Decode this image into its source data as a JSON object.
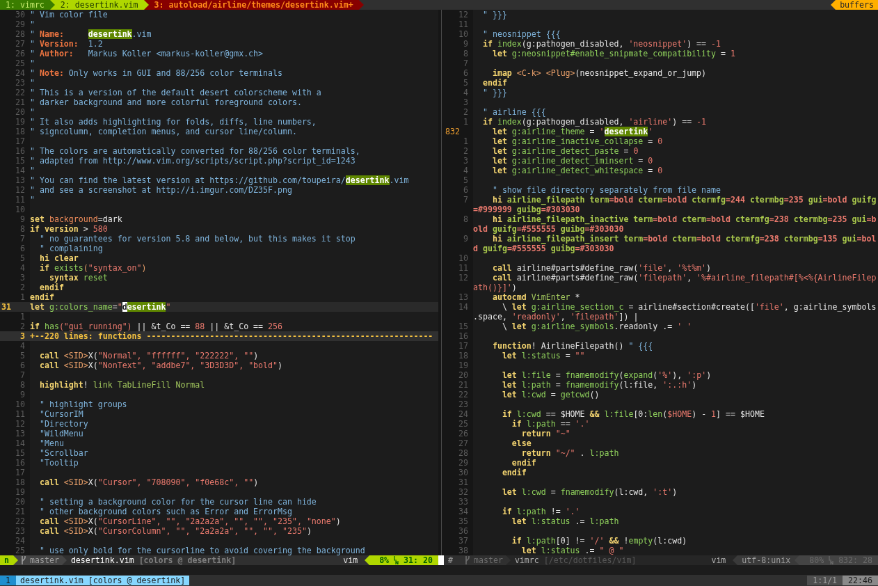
{
  "tabline": {
    "tabs": [
      {
        "label": "1: vimrc",
        "kind": "hidden",
        "selected": false
      },
      {
        "label": "2: desertink.vim",
        "kind": "visible",
        "selected": false
      },
      {
        "label": "3: autoload/airline/themes/desertink.vim+",
        "kind": "modified",
        "selected": true
      }
    ],
    "buffers_label": "buffers"
  },
  "panes": [
    {
      "active": true,
      "rows": [
        {
          "number": "30",
          "segments": [
            {
              "text": "\" Vim color file",
              "kind": "comment"
            }
          ]
        },
        {
          "number": "29",
          "segments": [
            {
              "text": "\"",
              "kind": "comment"
            }
          ]
        },
        {
          "number": "28",
          "segments": [
            {
              "text": "\" ",
              "kind": "comment"
            },
            {
              "text": "Name:     ",
              "kind": "label"
            },
            {
              "text": "desertink",
              "kind": "match"
            },
            {
              "text": ".vim",
              "kind": "comment"
            }
          ]
        },
        {
          "number": "27",
          "segments": [
            {
              "text": "\" ",
              "kind": "comment"
            },
            {
              "text": "Version:",
              "kind": "label"
            },
            {
              "text": "  1.2",
              "kind": "comment"
            }
          ]
        },
        {
          "number": "26",
          "segments": [
            {
              "text": "\" ",
              "kind": "comment"
            },
            {
              "text": "Author:",
              "kind": "label"
            },
            {
              "text": "   Markus Koller <markus-koller@gmx.ch>",
              "kind": "comment"
            }
          ]
        },
        {
          "number": "25",
          "segments": [
            {
              "text": "\"",
              "kind": "comment"
            }
          ]
        },
        {
          "number": "24",
          "segments": [
            {
              "text": "\" ",
              "kind": "comment"
            },
            {
              "text": "Note:",
              "kind": "label"
            },
            {
              "text": " Only works in GUI and 88/256 color terminals",
              "kind": "comment"
            }
          ]
        },
        {
          "number": "23",
          "segments": [
            {
              "text": "\"",
              "kind": "comment"
            }
          ]
        },
        {
          "number": "22",
          "segments": [
            {
              "text": "\" This is a version of the default desert colorscheme with a",
              "kind": "comment"
            }
          ]
        },
        {
          "number": "21",
          "segments": [
            {
              "text": "\" darker background and more colorful foreground colors.",
              "kind": "comment"
            }
          ]
        },
        {
          "number": "20",
          "segments": [
            {
              "text": "\"",
              "kind": "comment"
            }
          ]
        },
        {
          "number": "19",
          "segments": [
            {
              "text": "\" It also adds highlighting for folds, diffs, line numbers,",
              "kind": "comment"
            }
          ]
        },
        {
          "number": "18",
          "segments": [
            {
              "text": "\" signcolumn, completion menus, and cursor line/column.",
              "kind": "comment"
            }
          ]
        },
        {
          "number": "17"
        },
        {
          "number": "16",
          "segments": [
            {
              "text": "\" The colors are automatically converted for 88/256 color terminals,",
              "kind": "comment"
            }
          ]
        },
        {
          "number": "15",
          "segments": [
            {
              "text": "\" adapted from http://www.vim.org/scripts/script.php?script_id=1243",
              "kind": "comment"
            }
          ]
        },
        {
          "number": "14",
          "segments": [
            {
              "text": "\"",
              "kind": "comment"
            }
          ]
        },
        {
          "number": "13",
          "segments": [
            {
              "text": "\" You can find the latest version at https://github.com/toupeira/",
              "kind": "comment"
            },
            {
              "text": "desertink",
              "kind": "match"
            },
            {
              "text": ".vim",
              "kind": "comment"
            }
          ]
        },
        {
          "number": "12",
          "segments": [
            {
              "text": "\" and see a screenshot at http://i.imgur.com/DZ35F.png",
              "kind": "comment"
            }
          ]
        },
        {
          "number": "11",
          "segments": [
            {
              "text": "\"",
              "kind": "comment"
            }
          ]
        },
        {
          "number": "10"
        },
        {
          "number": "9",
          "segments": [
            {
              "text": "set ",
              "kind": "keyword"
            },
            {
              "text": "background",
              "kind": "option"
            },
            {
              "text": "=dark",
              "kind": "normal"
            }
          ]
        },
        {
          "number": "8",
          "segments": [
            {
              "text": "if version",
              "kind": "keyword"
            },
            {
              "text": " > ",
              "kind": "normal"
            },
            {
              "text": "580",
              "kind": "string"
            }
          ]
        },
        {
          "number": "7",
          "segments": [
            {
              "text": "  \" no guarantees for version 5.8 and below, but this makes it stop",
              "kind": "comment"
            }
          ]
        },
        {
          "number": "6",
          "segments": [
            {
              "text": "  \" complaining",
              "kind": "comment"
            }
          ]
        },
        {
          "number": "5",
          "segments": [
            {
              "text": "  hi clear",
              "kind": "keyword"
            }
          ]
        },
        {
          "number": "4",
          "segments": [
            {
              "text": "  if",
              "kind": "keyword"
            },
            {
              "text": " exists",
              "kind": "func"
            },
            {
              "text": "(",
              "kind": "special"
            },
            {
              "text": "\"syntax_on\"",
              "kind": "string"
            },
            {
              "text": ")",
              "kind": "special"
            }
          ]
        },
        {
          "number": "3",
          "segments": [
            {
              "text": "    syntax",
              "kind": "keyword"
            },
            {
              "text": " reset",
              "kind": "func"
            }
          ]
        },
        {
          "number": "2",
          "segments": [
            {
              "text": "  endif",
              "kind": "keyword"
            }
          ]
        },
        {
          "number": "1",
          "segments": [
            {
              "text": "endif",
              "kind": "keyword"
            }
          ]
        },
        {
          "number": "31",
          "kind": "cursor",
          "segments": [
            {
              "text": "let",
              "kind": "keyword"
            },
            {
              "text": " g:colors_name",
              "kind": "func"
            },
            {
              "text": "=",
              "kind": "normal"
            },
            {
              "text": "\"",
              "kind": "string"
            },
            {
              "text": "d",
              "kind": "cursor"
            },
            {
              "text": "esertink",
              "kind": "match"
            },
            {
              "text": "\"",
              "kind": "string"
            }
          ]
        },
        {
          "number": "1"
        },
        {
          "number": "2",
          "segments": [
            {
              "text": "if",
              "kind": "keyword"
            },
            {
              "text": " has",
              "kind": "func"
            },
            {
              "text": "(\"gui_running\")",
              "kind": "string"
            },
            {
              "text": " || &t_Co == ",
              "kind": "normal"
            },
            {
              "text": "88",
              "kind": "string"
            },
            {
              "text": " || &t_Co == ",
              "kind": "normal"
            },
            {
              "text": "256",
              "kind": "string"
            }
          ]
        },
        {
          "number": "3",
          "kind": "fold",
          "segments": [
            {
              "text": "+--220 lines: functions -----------------------------------------------------------",
              "kind": "fold"
            }
          ]
        },
        {
          "number": "4"
        },
        {
          "number": "5",
          "segments": [
            {
              "text": "  call",
              "kind": "keyword"
            },
            {
              "text": " <SID>",
              "kind": "special"
            },
            {
              "text": "X(",
              "kind": "normal"
            },
            {
              "text": "\"Normal\", \"ffffff\", \"222222\", \"\"",
              "kind": "string"
            },
            {
              "text": ")",
              "kind": "normal"
            }
          ]
        },
        {
          "number": "6",
          "segments": [
            {
              "text": "  call",
              "kind": "keyword"
            },
            {
              "text": " <SID>",
              "kind": "special"
            },
            {
              "text": "X(",
              "kind": "normal"
            },
            {
              "text": "\"NonText\", \"addbe7\", \"3D3D3D\", \"bold\"",
              "kind": "string"
            },
            {
              "text": ")",
              "kind": "normal"
            }
          ]
        },
        {
          "number": "7"
        },
        {
          "number": "8",
          "segments": [
            {
              "text": "  highlight",
              "kind": "keyword"
            },
            {
              "text": "! ",
              "kind": "normal"
            },
            {
              "text": "link TabLineFill Normal",
              "kind": "type"
            }
          ]
        },
        {
          "number": "9"
        },
        {
          "number": "10",
          "segments": [
            {
              "text": "  \" highlight groups",
              "kind": "comment"
            }
          ]
        },
        {
          "number": "11",
          "segments": [
            {
              "text": "  \"CursorIM",
              "kind": "comment"
            }
          ]
        },
        {
          "number": "12",
          "segments": [
            {
              "text": "  \"Directory",
              "kind": "comment"
            }
          ]
        },
        {
          "number": "13",
          "segments": [
            {
              "text": "  \"WildMenu",
              "kind": "comment"
            }
          ]
        },
        {
          "number": "14",
          "segments": [
            {
              "text": "  \"Menu",
              "kind": "comment"
            }
          ]
        },
        {
          "number": "15",
          "segments": [
            {
              "text": "  \"Scrollbar",
              "kind": "comment"
            }
          ]
        },
        {
          "number": "16",
          "segments": [
            {
              "text": "  \"Tooltip",
              "kind": "comment"
            }
          ]
        },
        {
          "number": "17"
        },
        {
          "number": "18",
          "segments": [
            {
              "text": "  call",
              "kind": "keyword"
            },
            {
              "text": " <SID>",
              "kind": "special"
            },
            {
              "text": "X(",
              "kind": "normal"
            },
            {
              "text": "\"Cursor\", \"708090\", \"f0e68c\", \"\"",
              "kind": "string"
            },
            {
              "text": ")",
              "kind": "normal"
            }
          ]
        },
        {
          "number": "19"
        },
        {
          "number": "20",
          "segments": [
            {
              "text": "  \" setting a background color for the cursor line can hide",
              "kind": "comment"
            }
          ]
        },
        {
          "number": "21",
          "segments": [
            {
              "text": "  \" other background colors such as Error and ErrorMsg",
              "kind": "comment"
            }
          ]
        },
        {
          "number": "22",
          "segments": [
            {
              "text": "  call",
              "kind": "keyword"
            },
            {
              "text": " <SID>",
              "kind": "special"
            },
            {
              "text": "X(",
              "kind": "normal"
            },
            {
              "text": "\"CursorLine\", \"\", \"2a2a2a\", \"\", \"\", \"235\", \"none\"",
              "kind": "string"
            },
            {
              "text": ")",
              "kind": "normal"
            }
          ]
        },
        {
          "number": "23",
          "segments": [
            {
              "text": "  call",
              "kind": "keyword"
            },
            {
              "text": " <SID>",
              "kind": "special"
            },
            {
              "text": "X(",
              "kind": "normal"
            },
            {
              "text": "\"CursorColumn\", \"\", \"2a2a2a\", \"\", \"\", \"235\"",
              "kind": "string"
            },
            {
              "text": ")",
              "kind": "normal"
            }
          ]
        },
        {
          "number": "24"
        },
        {
          "number": "25",
          "segments": [
            {
              "text": "  \" use only bold for the cursorline to avoid covering the background",
              "kind": "comment"
            }
          ]
        }
      ]
    },
    {
      "active": false,
      "rows": [
        {
          "number": "12",
          "segments": [
            {
              "text": "  \" }}}",
              "kind": "comment"
            }
          ]
        },
        {
          "number": "11"
        },
        {
          "number": "10",
          "segments": [
            {
              "text": "  \" neosnippet {{{",
              "kind": "comment"
            }
          ]
        },
        {
          "number": "9",
          "segments": [
            {
              "text": "  if",
              "kind": "keyword"
            },
            {
              "text": " index",
              "kind": "func"
            },
            {
              "text": "(g:pathogen_disabled, ",
              "kind": "normal"
            },
            {
              "text": "'neosnippet'",
              "kind": "string"
            },
            {
              "text": ") == ",
              "kind": "normal"
            },
            {
              "text": "-1",
              "kind": "string"
            }
          ]
        },
        {
          "number": "8",
          "segments": [
            {
              "text": "    let",
              "kind": "keyword"
            },
            {
              "text": " g:neosnippet#enable_snipmate_compatibility",
              "kind": "func"
            },
            {
              "text": " = ",
              "kind": "normal"
            },
            {
              "text": "1",
              "kind": "string"
            }
          ]
        },
        {
          "number": "7"
        },
        {
          "number": "6",
          "segments": [
            {
              "text": "    imap",
              "kind": "keyword"
            },
            {
              "text": " <C-k> <Plug>",
              "kind": "special"
            },
            {
              "text": "(neosnippet_expand_or_jump)",
              "kind": "normal"
            }
          ]
        },
        {
          "number": "5",
          "segments": [
            {
              "text": "  endif",
              "kind": "keyword"
            }
          ]
        },
        {
          "number": "4",
          "segments": [
            {
              "text": "  \" }}}",
              "kind": "comment"
            }
          ]
        },
        {
          "number": "3"
        },
        {
          "number": "2",
          "segments": [
            {
              "text": "  \" airline {{{",
              "kind": "comment"
            }
          ]
        },
        {
          "number": "1",
          "segments": [
            {
              "text": "  if",
              "kind": "keyword"
            },
            {
              "text": " index",
              "kind": "func"
            },
            {
              "text": "(g:pathogen_disabled, ",
              "kind": "normal"
            },
            {
              "text": "'airline'",
              "kind": "string"
            },
            {
              "text": ") == ",
              "kind": "normal"
            },
            {
              "text": "-1",
              "kind": "string"
            }
          ]
        },
        {
          "number": "832",
          "kind": "cursor",
          "segments": [
            {
              "text": "    let",
              "kind": "keyword"
            },
            {
              "text": " g:airline_theme",
              "kind": "func"
            },
            {
              "text": " = ",
              "kind": "normal"
            },
            {
              "text": "'",
              "kind": "string"
            },
            {
              "text": "desertink",
              "kind": "match"
            },
            {
              "text": "'",
              "kind": "string"
            }
          ]
        },
        {
          "number": "1",
          "segments": [
            {
              "text": "    let",
              "kind": "keyword"
            },
            {
              "text": " g:airline_inactive_collapse",
              "kind": "func"
            },
            {
              "text": " = ",
              "kind": "normal"
            },
            {
              "text": "0",
              "kind": "string"
            }
          ]
        },
        {
          "number": "2",
          "segments": [
            {
              "text": "    let",
              "kind": "keyword"
            },
            {
              "text": " g:airline_detect_paste",
              "kind": "func"
            },
            {
              "text": " = ",
              "kind": "normal"
            },
            {
              "text": "0",
              "kind": "string"
            }
          ]
        },
        {
          "number": "3",
          "segments": [
            {
              "text": "    let",
              "kind": "keyword"
            },
            {
              "text": " g:airline_detect_iminsert",
              "kind": "func"
            },
            {
              "text": " = ",
              "kind": "normal"
            },
            {
              "text": "0",
              "kind": "string"
            }
          ]
        },
        {
          "number": "4",
          "segments": [
            {
              "text": "    let",
              "kind": "keyword"
            },
            {
              "text": " g:airline_detect_whitespace",
              "kind": "func"
            },
            {
              "text": " = ",
              "kind": "normal"
            },
            {
              "text": "0",
              "kind": "string"
            }
          ]
        },
        {
          "number": "5"
        },
        {
          "number": "6",
          "segments": [
            {
              "text": "    \" show file directory separately from file name",
              "kind": "comment"
            }
          ]
        },
        {
          "number": "7",
          "segments": [
            {
              "text": "    hi",
              "kind": "keyword"
            },
            {
              "text": " airline_filepath term",
              "kind": "hiname"
            },
            {
              "text": "=bold",
              "kind": "hival"
            },
            {
              "text": " cterm",
              "kind": "hiname"
            },
            {
              "text": "=bold",
              "kind": "hival"
            },
            {
              "text": " ctermfg",
              "kind": "hiname"
            },
            {
              "text": "=244",
              "kind": "hival"
            },
            {
              "text": " ctermbg",
              "kind": "hiname"
            },
            {
              "text": "=235",
              "kind": "hival"
            },
            {
              "text": " gui",
              "kind": "hiname"
            },
            {
              "text": "=bold",
              "kind": "hival"
            },
            {
              "text": " guifg",
              "kind": "hiname"
            }
          ]
        },
        {
          "segments": [
            {
              "text": "=#999999",
              "kind": "hival"
            },
            {
              "text": " guibg",
              "kind": "hiname"
            },
            {
              "text": "=#303030",
              "kind": "hival"
            }
          ]
        },
        {
          "number": "8",
          "segments": [
            {
              "text": "    hi",
              "kind": "keyword"
            },
            {
              "text": " airline_filepath_inactive term",
              "kind": "hiname"
            },
            {
              "text": "=bold",
              "kind": "hival"
            },
            {
              "text": " cterm",
              "kind": "hiname"
            },
            {
              "text": "=bold",
              "kind": "hival"
            },
            {
              "text": " ctermfg",
              "kind": "hiname"
            },
            {
              "text": "=238",
              "kind": "hival"
            },
            {
              "text": " ctermbg",
              "kind": "hiname"
            },
            {
              "text": "=235",
              "kind": "hival"
            },
            {
              "text": " gui",
              "kind": "hiname"
            },
            {
              "text": "=b",
              "kind": "hival"
            }
          ]
        },
        {
          "segments": [
            {
              "text": "old",
              "kind": "hival"
            },
            {
              "text": " guifg",
              "kind": "hiname"
            },
            {
              "text": "=#555555",
              "kind": "hival"
            },
            {
              "text": " guibg",
              "kind": "hiname"
            },
            {
              "text": "=#303030",
              "kind": "hival"
            }
          ]
        },
        {
          "number": "9",
          "segments": [
            {
              "text": "    hi",
              "kind": "keyword"
            },
            {
              "text": " airline_filepath_insert term",
              "kind": "hiname"
            },
            {
              "text": "=bold",
              "kind": "hival"
            },
            {
              "text": " cterm",
              "kind": "hiname"
            },
            {
              "text": "=bold",
              "kind": "hival"
            },
            {
              "text": " ctermfg",
              "kind": "hiname"
            },
            {
              "text": "=238",
              "kind": "hival"
            },
            {
              "text": " ctermbg",
              "kind": "hiname"
            },
            {
              "text": "=135",
              "kind": "hival"
            },
            {
              "text": " gui",
              "kind": "hiname"
            },
            {
              "text": "=bol",
              "kind": "hival"
            }
          ]
        },
        {
          "segments": [
            {
              "text": "d",
              "kind": "hival"
            },
            {
              "text": " guifg",
              "kind": "hiname"
            },
            {
              "text": "=#555555",
              "kind": "hival"
            },
            {
              "text": " guibg",
              "kind": "hiname"
            },
            {
              "text": "=#303030",
              "kind": "hival"
            }
          ]
        },
        {
          "number": "10"
        },
        {
          "number": "11",
          "segments": [
            {
              "text": "    call",
              "kind": "keyword"
            },
            {
              "text": " airline#parts#define_raw(",
              "kind": "normal"
            },
            {
              "text": "'file'",
              "kind": "string"
            },
            {
              "text": ", ",
              "kind": "normal"
            },
            {
              "text": "'%t%m'",
              "kind": "string"
            },
            {
              "text": ")",
              "kind": "normal"
            }
          ]
        },
        {
          "number": "12",
          "segments": [
            {
              "text": "    call",
              "kind": "keyword"
            },
            {
              "text": " airline#parts#define_raw(",
              "kind": "normal"
            },
            {
              "text": "'filepath'",
              "kind": "string"
            },
            {
              "text": ", ",
              "kind": "normal"
            },
            {
              "text": "'%#airline_filepath#[%<%{AirlineFilep",
              "kind": "string"
            }
          ]
        },
        {
          "segments": [
            {
              "text": "ath()}]'",
              "kind": "string"
            },
            {
              "text": ")",
              "kind": "normal"
            }
          ]
        },
        {
          "number": "13",
          "segments": [
            {
              "text": "    autocmd",
              "kind": "keyword"
            },
            {
              "text": " VimEnter",
              "kind": "type"
            },
            {
              "text": " *",
              "kind": "normal"
            }
          ]
        },
        {
          "number": "14",
          "segments": [
            {
              "text": "      \\ ",
              "kind": "normal"
            },
            {
              "text": "let",
              "kind": "keyword"
            },
            {
              "text": " g:airline_section_c",
              "kind": "func"
            },
            {
              "text": " = airline#section#create([",
              "kind": "normal"
            },
            {
              "text": "'file'",
              "kind": "string"
            },
            {
              "text": ", g:airline_symbols",
              "kind": "normal"
            }
          ]
        },
        {
          "segments": [
            {
              "text": ".space, ",
              "kind": "normal"
            },
            {
              "text": "'readonly'",
              "kind": "string"
            },
            {
              "text": ", ",
              "kind": "normal"
            },
            {
              "text": "'filepath'",
              "kind": "string"
            },
            {
              "text": "]) |",
              "kind": "normal"
            }
          ]
        },
        {
          "number": "15",
          "segments": [
            {
              "text": "      \\ ",
              "kind": "normal"
            },
            {
              "text": "let",
              "kind": "keyword"
            },
            {
              "text": " g:airline_symbols",
              "kind": "func"
            },
            {
              "text": ".readonly .= ",
              "kind": "normal"
            },
            {
              "text": "' '",
              "kind": "string"
            }
          ]
        },
        {
          "number": "16"
        },
        {
          "number": "17",
          "segments": [
            {
              "text": "    function",
              "kind": "keyword"
            },
            {
              "text": "! AirlineFilepath() ",
              "kind": "normal"
            },
            {
              "text": "\" {{{",
              "kind": "comment"
            }
          ]
        },
        {
          "number": "18",
          "segments": [
            {
              "text": "      let",
              "kind": "keyword"
            },
            {
              "text": " l:status",
              "kind": "func"
            },
            {
              "text": " = ",
              "kind": "normal"
            },
            {
              "text": "\"\"",
              "kind": "string"
            }
          ]
        },
        {
          "number": "19"
        },
        {
          "number": "20",
          "segments": [
            {
              "text": "      let",
              "kind": "keyword"
            },
            {
              "text": " l:file",
              "kind": "func"
            },
            {
              "text": " = ",
              "kind": "normal"
            },
            {
              "text": "fnamemodify",
              "kind": "func"
            },
            {
              "text": "(",
              "kind": "normal"
            },
            {
              "text": "expand",
              "kind": "func"
            },
            {
              "text": "(",
              "kind": "normal"
            },
            {
              "text": "'%'",
              "kind": "string"
            },
            {
              "text": "), ",
              "kind": "normal"
            },
            {
              "text": "':p'",
              "kind": "string"
            },
            {
              "text": ")",
              "kind": "normal"
            }
          ]
        },
        {
          "number": "21",
          "segments": [
            {
              "text": "      let",
              "kind": "keyword"
            },
            {
              "text": " l:path",
              "kind": "func"
            },
            {
              "text": " = ",
              "kind": "normal"
            },
            {
              "text": "fnamemodify",
              "kind": "func"
            },
            {
              "text": "(l:file, ",
              "kind": "normal"
            },
            {
              "text": "':.:h'",
              "kind": "string"
            },
            {
              "text": ")",
              "kind": "normal"
            }
          ]
        },
        {
          "number": "22",
          "segments": [
            {
              "text": "      let",
              "kind": "keyword"
            },
            {
              "text": " l:cwd",
              "kind": "func"
            },
            {
              "text": " = ",
              "kind": "normal"
            },
            {
              "text": "getcwd",
              "kind": "func"
            },
            {
              "text": "()",
              "kind": "normal"
            }
          ]
        },
        {
          "number": "23"
        },
        {
          "number": "24",
          "segments": [
            {
              "text": "      if",
              "kind": "keyword"
            },
            {
              "text": " l:cwd",
              "kind": "func"
            },
            {
              "text": " == $HOME ",
              "kind": "normal"
            },
            {
              "text": "&&",
              "kind": "keyword"
            },
            {
              "text": " l:file",
              "kind": "func"
            },
            {
              "text": "[0:",
              "kind": "normal"
            },
            {
              "text": "len",
              "kind": "func"
            },
            {
              "text": "(",
              "kind": "normal"
            },
            {
              "text": "$HOME",
              "kind": "string"
            },
            {
              "text": ") - ",
              "kind": "normal"
            },
            {
              "text": "1",
              "kind": "string"
            },
            {
              "text": "] == $HOME",
              "kind": "normal"
            }
          ]
        },
        {
          "number": "25",
          "segments": [
            {
              "text": "        if",
              "kind": "keyword"
            },
            {
              "text": " l:path",
              "kind": "func"
            },
            {
              "text": " == ",
              "kind": "normal"
            },
            {
              "text": "'.'",
              "kind": "string"
            }
          ]
        },
        {
          "number": "26",
          "segments": [
            {
              "text": "          return ",
              "kind": "keyword"
            },
            {
              "text": "\"~\"",
              "kind": "string"
            }
          ]
        },
        {
          "number": "27",
          "segments": [
            {
              "text": "        else",
              "kind": "keyword"
            }
          ]
        },
        {
          "number": "28",
          "segments": [
            {
              "text": "          return ",
              "kind": "keyword"
            },
            {
              "text": "\"~/\"",
              "kind": "string"
            },
            {
              "text": " . ",
              "kind": "normal"
            },
            {
              "text": "l:path",
              "kind": "func"
            }
          ]
        },
        {
          "number": "29",
          "segments": [
            {
              "text": "        endif",
              "kind": "keyword"
            }
          ]
        },
        {
          "number": "30",
          "segments": [
            {
              "text": "      endif",
              "kind": "keyword"
            }
          ]
        },
        {
          "number": "31"
        },
        {
          "number": "32",
          "segments": [
            {
              "text": "      let",
              "kind": "keyword"
            },
            {
              "text": " l:cwd",
              "kind": "func"
            },
            {
              "text": " = ",
              "kind": "normal"
            },
            {
              "text": "fnamemodify",
              "kind": "func"
            },
            {
              "text": "(l:cwd, ",
              "kind": "normal"
            },
            {
              "text": "':t'",
              "kind": "string"
            },
            {
              "text": ")",
              "kind": "normal"
            }
          ]
        },
        {
          "number": "33"
        },
        {
          "number": "34",
          "segments": [
            {
              "text": "      if",
              "kind": "keyword"
            },
            {
              "text": " l:path",
              "kind": "func"
            },
            {
              "text": " != ",
              "kind": "normal"
            },
            {
              "text": "'.'",
              "kind": "string"
            }
          ]
        },
        {
          "number": "35",
          "segments": [
            {
              "text": "        let",
              "kind": "keyword"
            },
            {
              "text": " l:status",
              "kind": "func"
            },
            {
              "text": " .= ",
              "kind": "normal"
            },
            {
              "text": "l:path",
              "kind": "func"
            }
          ]
        },
        {
          "number": "36"
        },
        {
          "number": "37",
          "segments": [
            {
              "text": "        if",
              "kind": "keyword"
            },
            {
              "text": " l:path",
              "kind": "func"
            },
            {
              "text": "[0] != ",
              "kind": "normal"
            },
            {
              "text": "'/' ",
              "kind": "string"
            },
            {
              "text": "&&",
              "kind": "keyword"
            },
            {
              "text": " !",
              "kind": "normal"
            },
            {
              "text": "empty",
              "kind": "func"
            },
            {
              "text": "(l:cwd)",
              "kind": "normal"
            }
          ]
        },
        {
          "number": "38",
          "segments": [
            {
              "text": "          let",
              "kind": "keyword"
            },
            {
              "text": " l:status",
              "kind": "func"
            },
            {
              "text": " .= ",
              "kind": "normal"
            },
            {
              "text": "\" @ \"",
              "kind": "string"
            }
          ]
        }
      ]
    }
  ],
  "statuslines": [
    {
      "active": true,
      "mode": "n",
      "branch": "master",
      "file": "desertink.vim",
      "info": "[colors @ desertink]",
      "filetype": "vim",
      "percent": "8%",
      "position": "31: 20"
    },
    {
      "active": false,
      "mode": "#",
      "branch": "master",
      "file": "vimrc",
      "info": "[/etc/dotfiles/vim]",
      "filetype": "vim",
      "encoding": "utf-8:unix",
      "percent": "80%",
      "position": "832: 28"
    }
  ],
  "bufferline": {
    "buffers": [
      {
        "number": "1",
        "label": "desertink.vim [colors @ desertink]",
        "selected": true
      }
    ],
    "position": "1:1/1",
    "clock": "22:46"
  }
}
